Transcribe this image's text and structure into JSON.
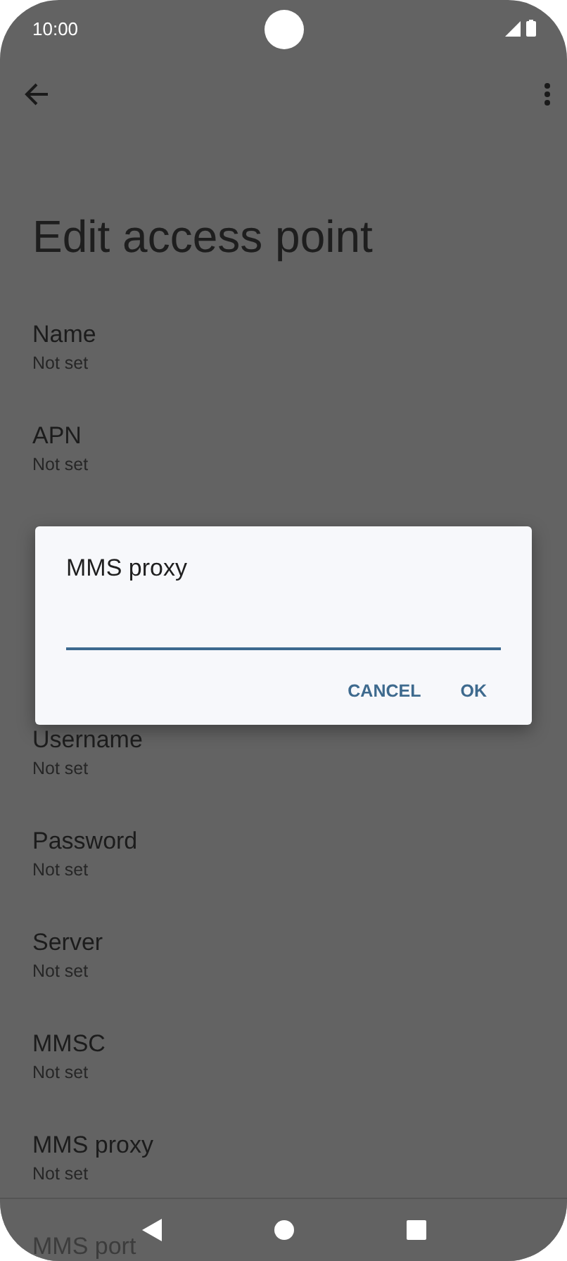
{
  "status_bar": {
    "time": "10:00"
  },
  "title": "Edit access point",
  "settings_above_dialog": [
    {
      "label": "Name",
      "value": "Not set"
    },
    {
      "label": "APN",
      "value": "Not set"
    }
  ],
  "settings_below_dialog": [
    {
      "label": "Username",
      "value": "Not set"
    },
    {
      "label": "Password",
      "value": "Not set"
    },
    {
      "label": "Server",
      "value": "Not set"
    },
    {
      "label": "MMSC",
      "value": "Not set"
    },
    {
      "label": "MMS proxy",
      "value": "Not set"
    },
    {
      "label": "MMS port"
    }
  ],
  "dialog": {
    "title": "MMS proxy",
    "buttons": [
      "CANCEL",
      "OK"
    ]
  }
}
